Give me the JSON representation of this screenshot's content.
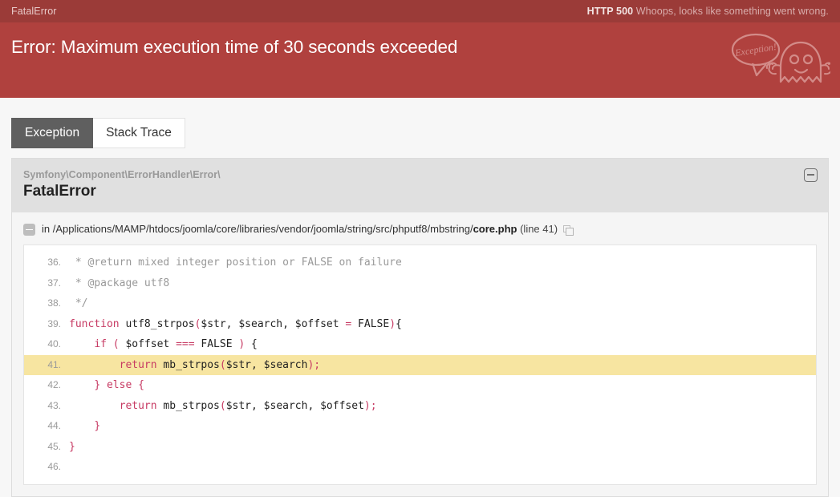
{
  "top_strip": {
    "exception_name": "FatalError",
    "status_code": "HTTP 500",
    "status_message": "Whoops, looks like something went wrong."
  },
  "header": {
    "title": "Error: Maximum execution time of 30 seconds exceeded",
    "mascot_bubble_text": "Exception!",
    "mascot_icon": "ghost-icon",
    "background_color": "#b0413e",
    "strip_color": "#9b3b38"
  },
  "tabs": [
    {
      "label": "Exception",
      "active": true
    },
    {
      "label": "Stack Trace",
      "active": false
    }
  ],
  "exception": {
    "namespace": "Symfony\\Component\\ErrorHandler\\Error\\",
    "class_name": "FatalError",
    "collapse_icon": "minus-square-icon"
  },
  "trace": {
    "toggle_icon": "minus-square-icon",
    "prefix": "in ",
    "dir_path": "/Applications/MAMP/htdocs/joomla/core/libraries/vendor/joomla/string/src/phputf8/mbstring/",
    "file_name": "core.php",
    "line_label": " (line 41)",
    "copy_icon": "copy-icon"
  },
  "code": {
    "highlight_line": 41,
    "highlight_color": "#f7e5a1",
    "lines": [
      {
        "number": "36.",
        "tokens": [
          {
            "t": "comment",
            "v": " * @return mixed integer position or FALSE on failure"
          }
        ]
      },
      {
        "number": "37.",
        "tokens": [
          {
            "t": "comment",
            "v": " * @package utf8"
          }
        ]
      },
      {
        "number": "38.",
        "tokens": [
          {
            "t": "comment",
            "v": " */"
          }
        ]
      },
      {
        "number": "39.",
        "tokens": [
          {
            "t": "keyword",
            "v": "function"
          },
          {
            "t": "plain",
            "v": " utf8_strpos"
          },
          {
            "t": "punct",
            "v": "("
          },
          {
            "t": "plain",
            "v": "$str, $search, $offset "
          },
          {
            "t": "keyword",
            "v": "="
          },
          {
            "t": "plain",
            "v": " FALSE"
          },
          {
            "t": "punct",
            "v": ")"
          },
          {
            "t": "plain",
            "v": "{"
          }
        ]
      },
      {
        "number": "40.",
        "tokens": [
          {
            "t": "plain",
            "v": "    "
          },
          {
            "t": "keyword",
            "v": "if"
          },
          {
            "t": "plain",
            "v": " "
          },
          {
            "t": "punct",
            "v": "("
          },
          {
            "t": "plain",
            "v": " $offset "
          },
          {
            "t": "keyword",
            "v": "==="
          },
          {
            "t": "plain",
            "v": " FALSE "
          },
          {
            "t": "punct",
            "v": ")"
          },
          {
            "t": "plain",
            "v": " {"
          }
        ]
      },
      {
        "number": "41.",
        "highlight": true,
        "tokens": [
          {
            "t": "plain",
            "v": "        "
          },
          {
            "t": "keyword",
            "v": "return"
          },
          {
            "t": "plain",
            "v": " mb_strpos"
          },
          {
            "t": "punct",
            "v": "("
          },
          {
            "t": "plain",
            "v": "$str, $search"
          },
          {
            "t": "punct",
            "v": ");"
          }
        ]
      },
      {
        "number": "42.",
        "tokens": [
          {
            "t": "plain",
            "v": "    "
          },
          {
            "t": "punct",
            "v": "}"
          },
          {
            "t": "plain",
            "v": " "
          },
          {
            "t": "keyword",
            "v": "else"
          },
          {
            "t": "plain",
            "v": " "
          },
          {
            "t": "punct",
            "v": "{"
          }
        ]
      },
      {
        "number": "43.",
        "tokens": [
          {
            "t": "plain",
            "v": "        "
          },
          {
            "t": "keyword",
            "v": "return"
          },
          {
            "t": "plain",
            "v": " mb_strpos"
          },
          {
            "t": "punct",
            "v": "("
          },
          {
            "t": "plain",
            "v": "$str, $search, $offset"
          },
          {
            "t": "punct",
            "v": ");"
          }
        ]
      },
      {
        "number": "44.",
        "tokens": [
          {
            "t": "plain",
            "v": "    "
          },
          {
            "t": "punct",
            "v": "}"
          }
        ]
      },
      {
        "number": "45.",
        "tokens": [
          {
            "t": "punct",
            "v": "}"
          }
        ]
      },
      {
        "number": "46.",
        "tokens": [
          {
            "t": "plain",
            "v": ""
          }
        ]
      }
    ]
  }
}
